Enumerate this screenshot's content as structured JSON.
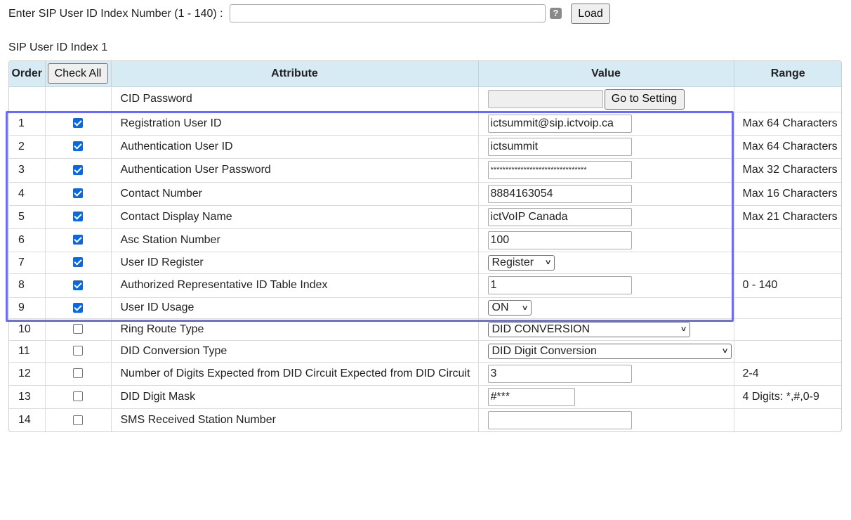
{
  "top": {
    "label": "Enter SIP User ID Index Number (1 - 140) :",
    "index_value": "",
    "help_glyph": "?",
    "load_label": "Load"
  },
  "section_title": "SIP User ID Index 1",
  "table": {
    "headers": {
      "order": "Order",
      "check_all": "Check All",
      "attribute": "Attribute",
      "value": "Value",
      "range": "Range"
    },
    "cid_row": {
      "attribute": "CID Password",
      "value": "",
      "button_label": "Go to Setting"
    },
    "rows": [
      {
        "order": "1",
        "checked": true,
        "attribute": "Registration User ID",
        "value": "ictsummit@sip.ictvoip.ca",
        "range": "Max 64 Characters"
      },
      {
        "order": "2",
        "checked": true,
        "attribute": "Authentication User ID",
        "value": "ictsummit",
        "range": "Max 64 Characters"
      },
      {
        "order": "3",
        "checked": true,
        "attribute": "Authentication User Password",
        "value": "********************************",
        "range": "Max 32 Characters"
      },
      {
        "order": "4",
        "checked": true,
        "attribute": "Contact Number",
        "value": "8884163054",
        "range": "Max 16 Characters"
      },
      {
        "order": "5",
        "checked": true,
        "attribute": "Contact Display Name",
        "value": "ictVoIP Canada",
        "range": "Max 21 Characters"
      },
      {
        "order": "6",
        "checked": true,
        "attribute": "Asc Station Number",
        "value": "100",
        "range": ""
      },
      {
        "order": "7",
        "checked": true,
        "attribute": "User ID Register",
        "value": "Register",
        "range": ""
      },
      {
        "order": "8",
        "checked": true,
        "attribute": "Authorized Representative ID Table Index",
        "value": "1",
        "range": "0 - 140"
      },
      {
        "order": "9",
        "checked": true,
        "attribute": "User ID Usage",
        "value": "ON",
        "range": ""
      },
      {
        "order": "10",
        "checked": false,
        "attribute": "Ring Route Type",
        "value": "DID CONVERSION",
        "range": ""
      },
      {
        "order": "11",
        "checked": false,
        "attribute": "DID Conversion Type",
        "value": "DID Digit Conversion",
        "range": ""
      },
      {
        "order": "12",
        "checked": false,
        "attribute": "Number of Digits Expected from DID Circuit Expected from DID Circuit",
        "value": "3",
        "range": "2-4"
      },
      {
        "order": "13",
        "checked": false,
        "attribute": "DID Digit Mask",
        "value": "#***",
        "range": "4 Digits: *,#,0-9"
      },
      {
        "order": "14",
        "checked": false,
        "attribute": "SMS Received Station Number",
        "value": "",
        "range": ""
      }
    ]
  },
  "colors": {
    "header_bg": "#d7ebf4",
    "checkbox_on": "#0b68e0",
    "highlight_border": "#6c6cf0"
  }
}
